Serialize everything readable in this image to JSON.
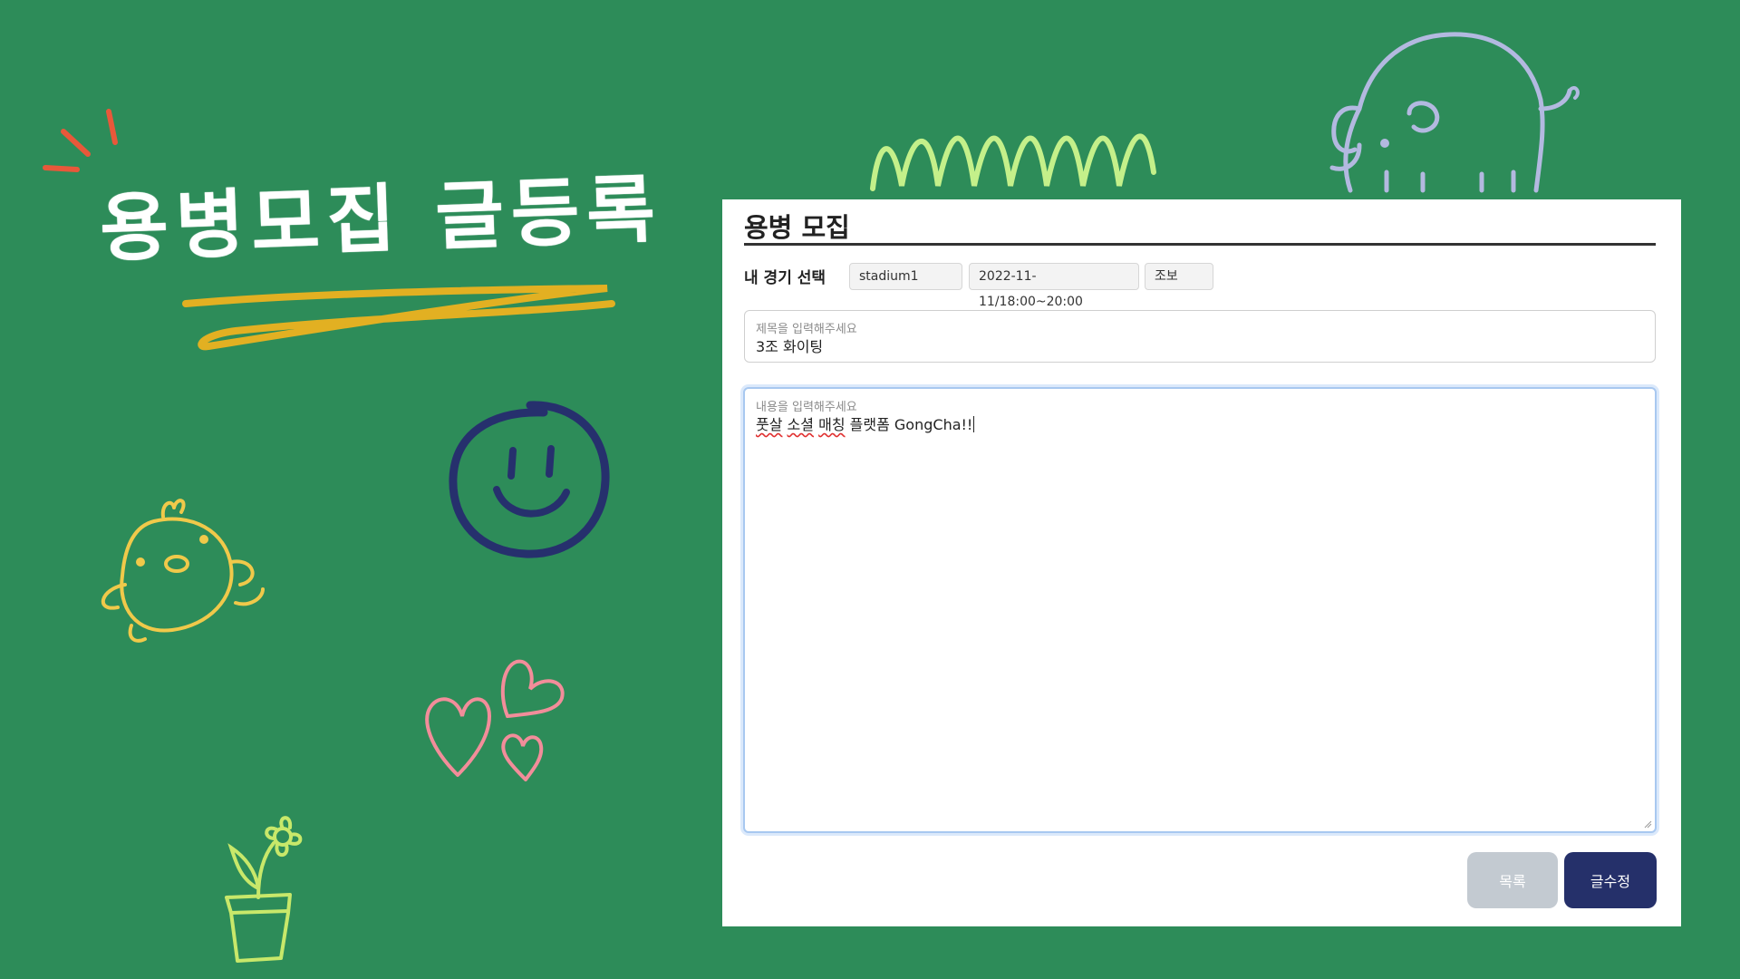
{
  "hero": {
    "title": "용병모집 글등록"
  },
  "panel": {
    "title": "용병 모집",
    "game_select_label": "내 경기 선택",
    "chips": [
      "stadium1",
      "2022-11-11/18:00~20:00",
      "조보"
    ],
    "title_field": {
      "placeholder": "제목을 입력해주세요",
      "value": "3조 화이팅"
    },
    "content_field": {
      "placeholder": "내용을 입력해주세요",
      "words": [
        "풋살",
        "소셜",
        "매칭",
        "플랫폼",
        "GongCha!!"
      ]
    },
    "buttons": {
      "list": "목록",
      "edit": "글수정"
    }
  },
  "colors": {
    "background": "#2d8c59",
    "list_button": "#c3cad1",
    "edit_button": "#25306a",
    "focus_ring": "#a8c8f0"
  }
}
